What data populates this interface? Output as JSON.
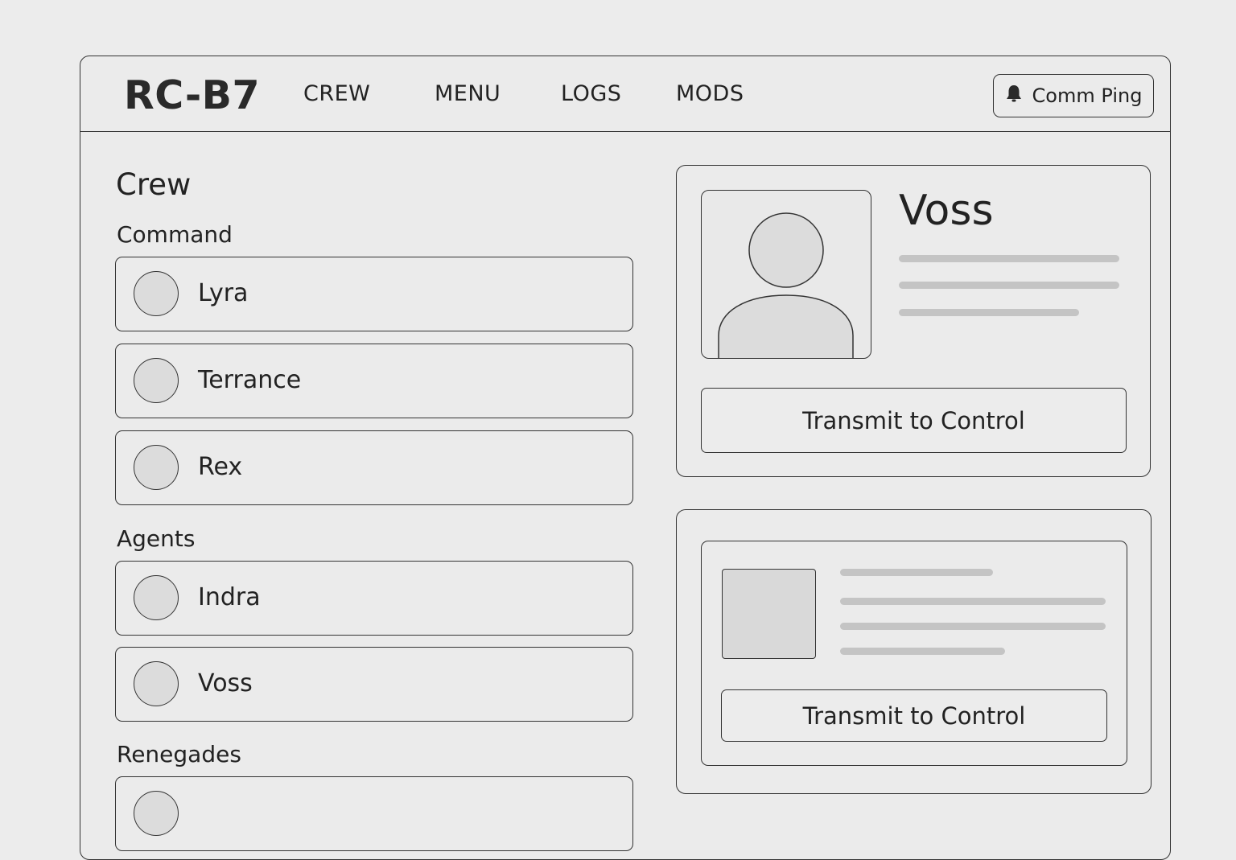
{
  "header": {
    "brand": "RC-B7",
    "nav": [
      "CREW",
      "MENU",
      "LOGS",
      "MODS"
    ],
    "comm_ping": {
      "label": "Comm Ping",
      "icon": "bell-icon"
    }
  },
  "crew": {
    "title": "Crew",
    "groups": [
      {
        "label": "Command",
        "members": [
          "Lyra",
          "Terrance",
          "Rex"
        ]
      },
      {
        "label": "Agents",
        "members": [
          "Indra",
          "Voss"
        ]
      },
      {
        "label": "Renegades",
        "members": [
          ""
        ]
      }
    ]
  },
  "profile": {
    "name": "Voss",
    "avatar_icon": "user-silhouette-icon",
    "transmit_label": "Transmit to Control"
  },
  "secondary": {
    "image_icon": "image-placeholder-icon",
    "transmit_label": "Transmit to Control"
  },
  "colors": {
    "background": "#ececec",
    "border": "#333333",
    "placeholder": "#c4c4c4",
    "avatar_fill": "#dcdcdc"
  }
}
